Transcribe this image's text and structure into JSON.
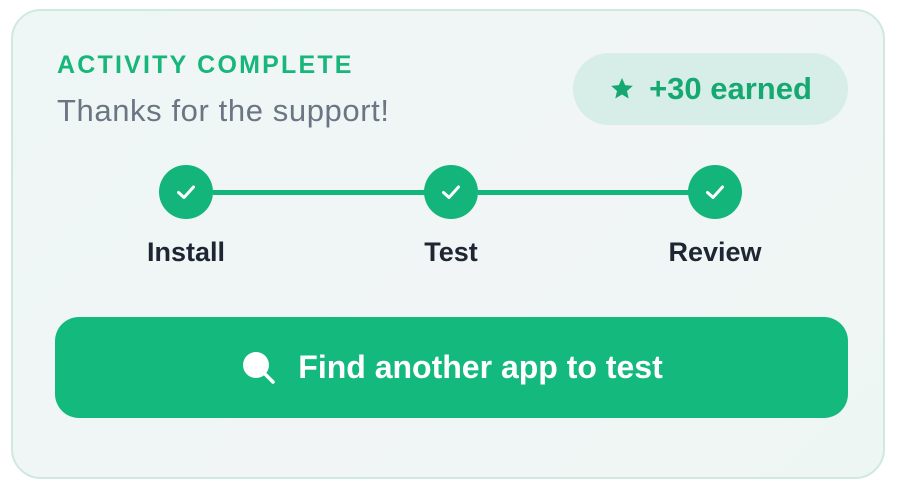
{
  "card": {
    "eyebrow": "ACTIVITY COMPLETE",
    "subtitle": "Thanks for the support!",
    "badge": {
      "icon": "star-icon",
      "text": "+30 earned"
    },
    "steps": [
      {
        "label": "Install",
        "status": "complete",
        "icon": "checkmark-icon"
      },
      {
        "label": "Test",
        "status": "complete",
        "icon": "checkmark-icon"
      },
      {
        "label": "Review",
        "status": "complete",
        "icon": "checkmark-icon"
      }
    ],
    "cta": {
      "icon": "search-icon",
      "label": "Find another app to test"
    }
  },
  "colors": {
    "accent": "#14b57a",
    "accent_light": "#d6eee7",
    "heading": "#17b67a",
    "muted_text": "#6b7584",
    "dark_text": "#1e2533",
    "card_border": "#cfe9e1"
  }
}
